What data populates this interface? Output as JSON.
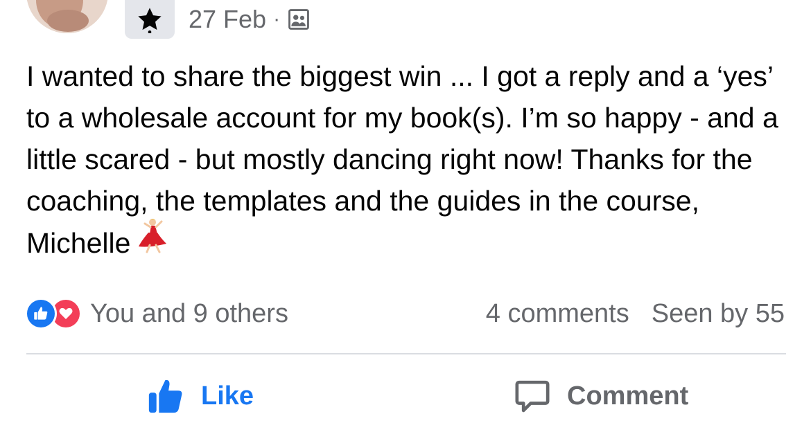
{
  "post": {
    "date": "27 Feb",
    "separator": "·",
    "audience_icon": "members-group-icon",
    "badge_icon": "star-icon",
    "text": "I wanted to share the biggest win ... I got a reply and a ‘yes’ to a wholesale account for my book(s). I’m so happy - and a little scared - but mostly dancing right now! Thanks for the coaching, the templates and the guides in the course, Michelle",
    "emoji": "woman-dancing-emoji"
  },
  "reactions": {
    "types": [
      "like",
      "love"
    ],
    "summary": "You and 9 others"
  },
  "stats": {
    "comments": "4 comments",
    "seen": "Seen by 55"
  },
  "actions": {
    "like_label": "Like",
    "comment_label": "Comment"
  },
  "colors": {
    "accent": "#1877f2",
    "love": "#f33e58",
    "secondary_text": "#65676b",
    "divider": "#dadde1"
  }
}
